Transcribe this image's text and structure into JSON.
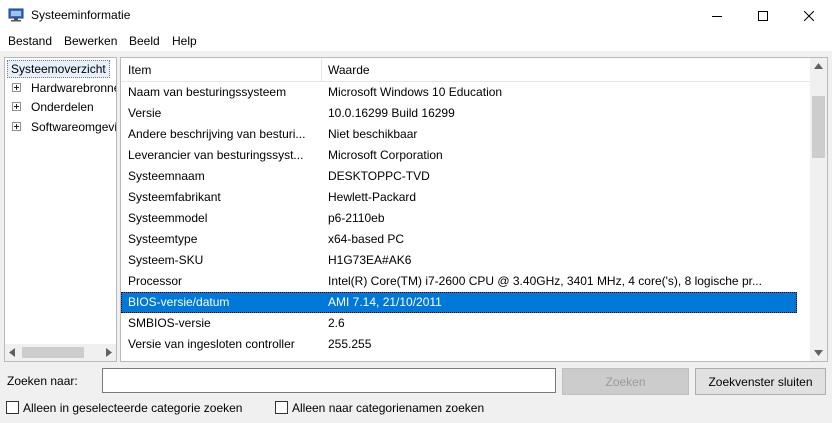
{
  "window": {
    "title": "Systeeminformatie",
    "icon": "system-information-icon",
    "minimize": "minimize-icon",
    "maximize": "maximize-icon",
    "close": "close-icon"
  },
  "menu": [
    "Bestand",
    "Bewerken",
    "Beeld",
    "Help"
  ],
  "tree": {
    "root": "Systeemoverzicht",
    "children": [
      "Hardwarebronnen",
      "Onderdelen",
      "Softwareomgeving"
    ]
  },
  "table": {
    "columns": [
      "Item",
      "Waarde"
    ],
    "rows": [
      {
        "item": "Naam van besturingssysteem",
        "value": "Microsoft Windows 10 Education"
      },
      {
        "item": "Versie",
        "value": "10.0.16299 Build 16299"
      },
      {
        "item": "Andere beschrijving van besturi...",
        "value": "Niet beschikbaar"
      },
      {
        "item": "Leverancier van besturingssyst...",
        "value": "Microsoft Corporation"
      },
      {
        "item": "Systeemnaam",
        "value": "DESKTOPPC-TVD"
      },
      {
        "item": "Systeemfabrikant",
        "value": "Hewlett-Packard"
      },
      {
        "item": "Systeemmodel",
        "value": "p6-2110eb"
      },
      {
        "item": "Systeemtype",
        "value": "x64-based PC"
      },
      {
        "item": "Systeem-SKU",
        "value": "H1G73EA#AK6"
      },
      {
        "item": "Processor",
        "value": "Intel(R) Core(TM) i7-2600 CPU @ 3.40GHz, 3401 MHz, 4 core('s), 8 logische pr..."
      },
      {
        "item": "BIOS-versie/datum",
        "value": "AMI 7.14, 21/10/2011",
        "selected": true
      },
      {
        "item": "SMBIOS-versie",
        "value": "2.6"
      },
      {
        "item": "Versie van ingesloten controller",
        "value": "255.255"
      }
    ]
  },
  "search": {
    "label": "Zoeken naar:",
    "value": "",
    "find_button": "Zoeken",
    "close_button": "Zoekvenster sluiten",
    "option_selected_category": "Alleen in geselecteerde categorie zoeken",
    "option_category_names": "Alleen naar categorienamen zoeken"
  },
  "colors": {
    "selection": "#0078d7",
    "window_bg": "#f0f0f0"
  }
}
